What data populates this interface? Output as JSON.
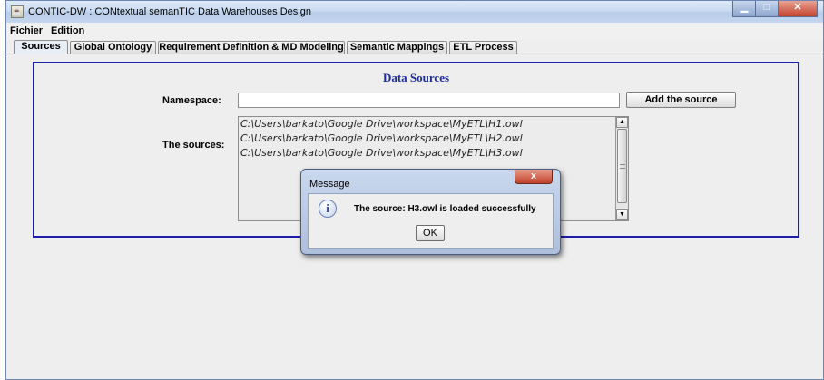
{
  "window": {
    "title": "CONTIC-DW : CONtextual semanTIC Data Warehouses Design",
    "app_icon": "java-cup-icon",
    "minimize_glyph": "▁",
    "maximize_glyph": "□",
    "close_glyph": "✕"
  },
  "menu": {
    "items": [
      "Fichier",
      "Edition"
    ]
  },
  "tabs": [
    {
      "label": "Sources",
      "active": true
    },
    {
      "label": "Global Ontology",
      "active": false
    },
    {
      "label": "Requirement Definition & MD Modeling",
      "active": false
    },
    {
      "label": "Semantic Mappings",
      "active": false
    },
    {
      "label": "ETL Process",
      "active": false
    }
  ],
  "panel": {
    "title": "Data Sources",
    "namespace_label": "Namespace:",
    "namespace_value": "",
    "add_button": "Add the source",
    "sources_label": "The sources:",
    "sources": [
      "C:\\Users\\barkato\\Google Drive\\workspace\\MyETL\\H1.owl",
      "C:\\Users\\barkato\\Google Drive\\workspace\\MyETL\\H2.owl",
      "C:\\Users\\barkato\\Google Drive\\workspace\\MyETL\\H3.owl"
    ]
  },
  "dialog": {
    "title": "Message",
    "close_glyph": "x",
    "icon": "info-icon",
    "icon_glyph": "i",
    "message": "The source: H3.owl is loaded successfully",
    "ok_button": "OK"
  },
  "colors": {
    "panel_border": "#1d1da8",
    "panel_title": "#1c2c9c",
    "close_button": "#c4422e"
  }
}
